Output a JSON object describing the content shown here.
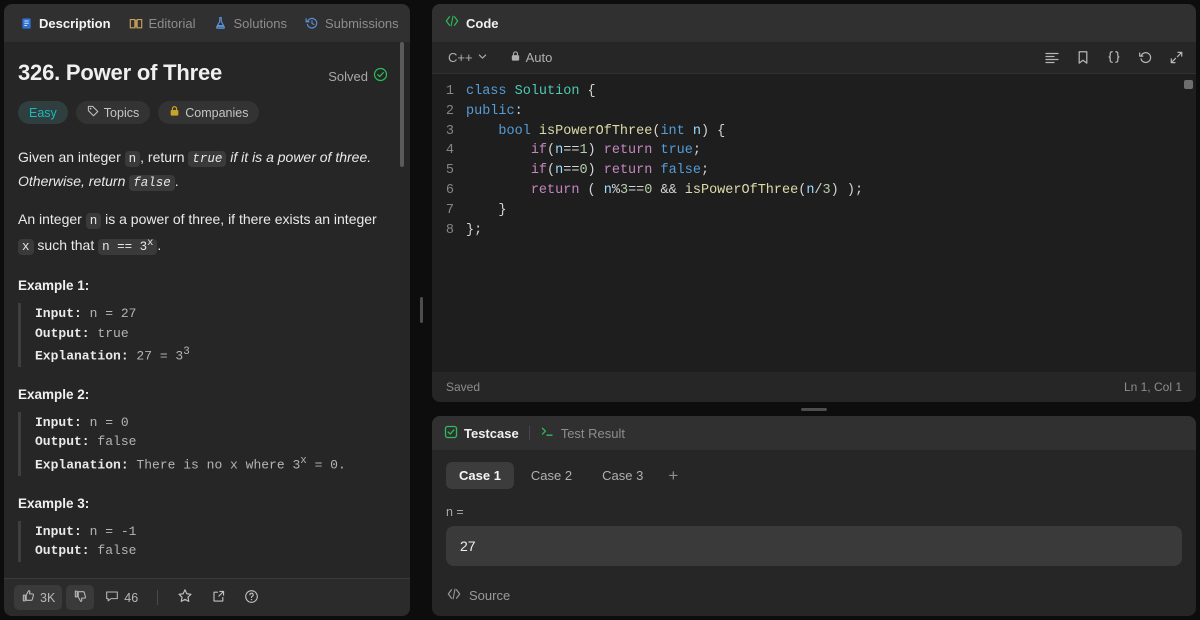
{
  "left": {
    "tabs": [
      {
        "label": "Description",
        "icon": "document-icon",
        "active": true
      },
      {
        "label": "Editorial",
        "icon": "book-icon",
        "active": false
      },
      {
        "label": "Solutions",
        "icon": "flask-icon",
        "active": false
      },
      {
        "label": "Submissions",
        "icon": "history-icon",
        "active": false
      }
    ],
    "problem": {
      "title": "326. Power of Three",
      "solved_label": "Solved",
      "difficulty": "Easy",
      "topics_label": "Topics",
      "companies_label": "Companies",
      "statement_1_a": "Given an integer ",
      "statement_1_n": "n",
      "statement_1_b": ", return ",
      "statement_1_true": "true",
      "statement_1_c": " if it is a power of three. Otherwise, return ",
      "statement_1_false": "false",
      "statement_1_d": ".",
      "statement_2_a": "An integer ",
      "statement_2_n": "n",
      "statement_2_b": " is a power of three, if there exists an integer ",
      "statement_2_x": "x",
      "statement_2_c": " such that ",
      "statement_2_eq": "n == 3",
      "statement_2_sup": "x",
      "statement_2_d": "."
    },
    "examples": [
      {
        "title": "Example 1:",
        "input_label": "Input:",
        "input_value": " n = 27",
        "output_label": "Output:",
        "output_value": " true",
        "explanation_label": "Explanation:",
        "explanation_value": " 27 = 3",
        "explanation_sup": "3",
        "explanation_tail": ""
      },
      {
        "title": "Example 2:",
        "input_label": "Input:",
        "input_value": " n = 0",
        "output_label": "Output:",
        "output_value": " false",
        "explanation_label": "Explanation:",
        "explanation_value": " There is no x where 3",
        "explanation_sup": "x",
        "explanation_tail": " = 0."
      },
      {
        "title": "Example 3:",
        "input_label": "Input:",
        "input_value": " n = -1",
        "output_label": "Output:",
        "output_value": " false",
        "explanation_label": "",
        "explanation_value": "",
        "explanation_sup": "",
        "explanation_tail": ""
      }
    ],
    "actions": {
      "upvote_count": "3K",
      "upvote_icon": "thumbs-up-icon",
      "downvote_icon": "thumbs-down-icon",
      "comment_count": "46",
      "comment_icon": "comment-icon",
      "star_icon": "star-icon",
      "share_icon": "share-icon",
      "help_icon": "help-icon"
    }
  },
  "code_panel": {
    "header_label": "Code",
    "header_icon": "code-brackets-icon",
    "language": "C++",
    "language_caret": "chevron-down-icon",
    "auto_label": "Auto",
    "auto_icon": "lock-icon",
    "toolbar_icons": [
      "format-lines-icon",
      "bookmark-icon",
      "curly-braces-icon",
      "reset-undo-icon",
      "expand-icon"
    ],
    "lines": [
      {
        "num": "1",
        "tokens": [
          {
            "t": "class",
            "c": "k"
          },
          {
            "t": " ",
            "c": "ctext"
          },
          {
            "t": "Solution",
            "c": "t"
          },
          {
            "t": " {",
            "c": "ctext"
          }
        ]
      },
      {
        "num": "2",
        "tokens": [
          {
            "t": "public",
            "c": "k"
          },
          {
            "t": ":",
            "c": "ctext"
          }
        ]
      },
      {
        "num": "3",
        "tokens": [
          {
            "t": "    ",
            "c": "ctext"
          },
          {
            "t": "bool",
            "c": "k"
          },
          {
            "t": " ",
            "c": "ctext"
          },
          {
            "t": "isPowerOfThree",
            "c": "f"
          },
          {
            "t": "(",
            "c": "ctext"
          },
          {
            "t": "int",
            "c": "k"
          },
          {
            "t": " ",
            "c": "ctext"
          },
          {
            "t": "n",
            "c": "v"
          },
          {
            "t": ") {",
            "c": "ctext"
          }
        ]
      },
      {
        "num": "4",
        "tokens": [
          {
            "t": "        ",
            "c": "ctext"
          },
          {
            "t": "if",
            "c": "kc"
          },
          {
            "t": "(",
            "c": "ctext"
          },
          {
            "t": "n",
            "c": "v"
          },
          {
            "t": "==",
            "c": "ctext"
          },
          {
            "t": "1",
            "c": "n"
          },
          {
            "t": ") ",
            "c": "ctext"
          },
          {
            "t": "return",
            "c": "kc"
          },
          {
            "t": " ",
            "c": "ctext"
          },
          {
            "t": "true",
            "c": "k"
          },
          {
            "t": ";",
            "c": "ctext"
          }
        ]
      },
      {
        "num": "5",
        "tokens": [
          {
            "t": "        ",
            "c": "ctext"
          },
          {
            "t": "if",
            "c": "kc"
          },
          {
            "t": "(",
            "c": "ctext"
          },
          {
            "t": "n",
            "c": "v"
          },
          {
            "t": "==",
            "c": "ctext"
          },
          {
            "t": "0",
            "c": "n"
          },
          {
            "t": ") ",
            "c": "ctext"
          },
          {
            "t": "return",
            "c": "kc"
          },
          {
            "t": " ",
            "c": "ctext"
          },
          {
            "t": "false",
            "c": "k"
          },
          {
            "t": ";",
            "c": "ctext"
          }
        ]
      },
      {
        "num": "6",
        "tokens": [
          {
            "t": "        ",
            "c": "ctext"
          },
          {
            "t": "return",
            "c": "kc"
          },
          {
            "t": " ( ",
            "c": "ctext"
          },
          {
            "t": "n",
            "c": "v"
          },
          {
            "t": "%",
            "c": "ctext"
          },
          {
            "t": "3",
            "c": "n"
          },
          {
            "t": "==",
            "c": "ctext"
          },
          {
            "t": "0",
            "c": "n"
          },
          {
            "t": " && ",
            "c": "ctext"
          },
          {
            "t": "isPowerOfThree",
            "c": "f"
          },
          {
            "t": "(",
            "c": "ctext"
          },
          {
            "t": "n",
            "c": "v"
          },
          {
            "t": "/",
            "c": "ctext"
          },
          {
            "t": "3",
            "c": "n"
          },
          {
            "t": ") );",
            "c": "ctext"
          }
        ]
      },
      {
        "num": "7",
        "tokens": [
          {
            "t": "    }",
            "c": "ctext"
          }
        ]
      },
      {
        "num": "8",
        "tokens": [
          {
            "t": "};",
            "c": "ctext"
          }
        ]
      }
    ],
    "footer_status": "Saved",
    "footer_cursor": "Ln 1, Col 1"
  },
  "test_panel": {
    "tabs": [
      {
        "label": "Testcase",
        "icon": "checkbox-check-icon",
        "active": true
      },
      {
        "label": "Test Result",
        "icon": "terminal-icon",
        "active": false
      }
    ],
    "cases": [
      {
        "label": "Case 1",
        "active": true
      },
      {
        "label": "Case 2",
        "active": false
      },
      {
        "label": "Case 3",
        "active": false
      }
    ],
    "add_case_icon": "plus-icon",
    "input_label": "n =",
    "input_value": "27",
    "source_label": "Source",
    "source_icon": "code-brackets-icon"
  },
  "colors": {
    "accent_green": "#2cbb5d",
    "easy_teal": "#1cbaba",
    "panel_bg": "#262626",
    "editor_bg": "#1e1e1e",
    "app_bg": "#0d0d0d"
  }
}
